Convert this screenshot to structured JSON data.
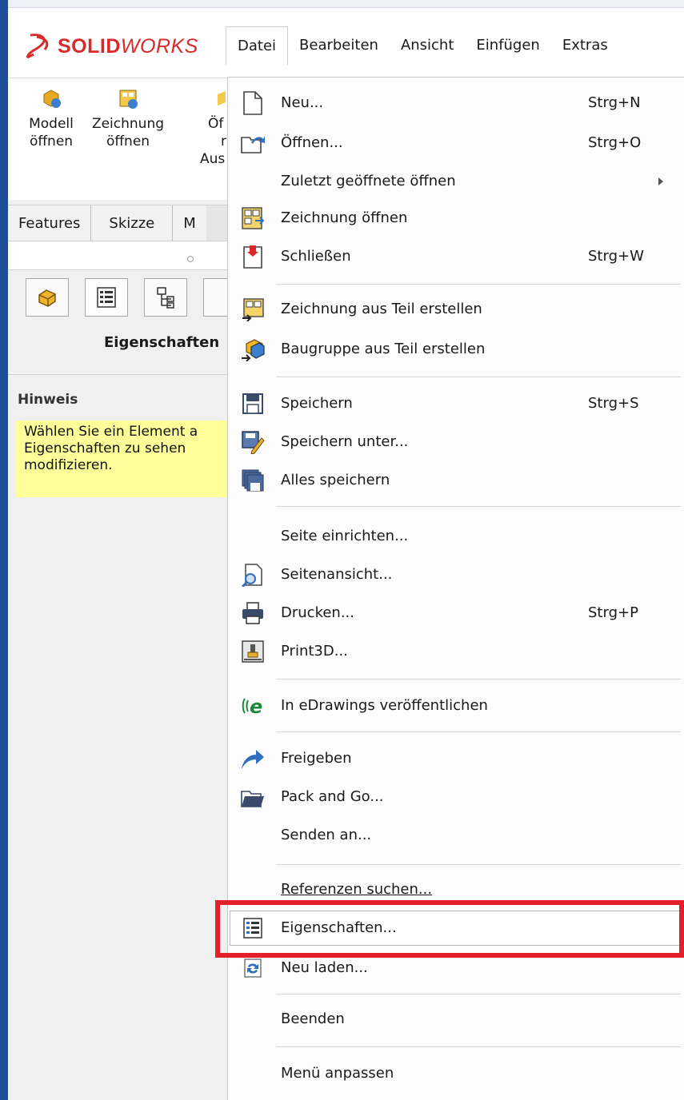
{
  "titlebar": {
    "logo": {
      "ds": "3S",
      "solid": "SOLID",
      "works": "WORKS"
    },
    "menus": [
      {
        "label": "Datei",
        "active": true
      },
      {
        "label": "Bearbeiten"
      },
      {
        "label": "Ansicht"
      },
      {
        "label": "Einfügen"
      },
      {
        "label": "Extras"
      }
    ]
  },
  "command_manager": {
    "items": [
      {
        "line1": "Modell",
        "line2": "öffnen",
        "line3": ""
      },
      {
        "line1": "Zeichnung",
        "line2": "öffnen",
        "line3": ""
      },
      {
        "line1": "Öf",
        "line2": "r",
        "line3": "Aus"
      }
    ]
  },
  "tabs": [
    "Features",
    "Skizze",
    "M"
  ],
  "property_panel": {
    "title": "Eigenschaften",
    "hint_title": "Hinweis",
    "hint_text": "Wählen Sie ein Element a\nEigenschaften zu sehen\nmodifizieren."
  },
  "file_menu": {
    "items": [
      {
        "label": "Neu...",
        "shortcut": "Strg+N",
        "icon": "new-document-icon"
      },
      {
        "label": "Öffnen...",
        "shortcut": "Strg+O",
        "icon": "open-folder-icon"
      },
      {
        "label": "Zuletzt geöffnete öffnen",
        "shortcut": "",
        "icon": "",
        "submenu": true
      },
      {
        "label": "Zeichnung öffnen",
        "shortcut": "",
        "icon": "drawing-open-icon"
      },
      {
        "label": "Schließen",
        "shortcut": "Strg+W",
        "icon": "close-document-icon"
      },
      {
        "label": "Zeichnung aus Teil erstellen",
        "shortcut": "",
        "icon": "drawing-from-part-icon"
      },
      {
        "label": "Baugruppe aus Teil erstellen",
        "shortcut": "",
        "icon": "assembly-from-part-icon"
      },
      {
        "label": "Speichern",
        "shortcut": "Strg+S",
        "icon": "save-icon"
      },
      {
        "label": "Speichern unter...",
        "shortcut": "",
        "icon": "save-as-icon"
      },
      {
        "label": "Alles speichern",
        "shortcut": "",
        "icon": "save-all-icon"
      },
      {
        "label": "Seite einrichten...",
        "shortcut": "",
        "icon": ""
      },
      {
        "label": "Seitenansicht...",
        "shortcut": "",
        "icon": "print-preview-icon"
      },
      {
        "label": "Drucken...",
        "shortcut": "Strg+P",
        "icon": "printer-icon"
      },
      {
        "label": "Print3D...",
        "shortcut": "",
        "icon": "print3d-icon"
      },
      {
        "label": "In eDrawings veröffentlichen",
        "shortcut": "",
        "icon": "edrawings-icon"
      },
      {
        "label": "Freigeben",
        "shortcut": "",
        "icon": "share-arrow-icon"
      },
      {
        "label": "Pack and Go...",
        "shortcut": "",
        "icon": "pack-and-go-icon"
      },
      {
        "label": "Senden an...",
        "shortcut": "",
        "icon": ""
      },
      {
        "label": "Referenzen suchen...",
        "shortcut": "",
        "icon": ""
      },
      {
        "label": "Eigenschaften...",
        "shortcut": "",
        "icon": "properties-icon",
        "hovered": true
      },
      {
        "label": "Neu laden...",
        "shortcut": "",
        "icon": "reload-icon"
      },
      {
        "label": "Beenden",
        "shortcut": "",
        "icon": ""
      },
      {
        "label": "Menü anpassen",
        "shortcut": "",
        "icon": ""
      }
    ]
  },
  "colors": {
    "accent": "#e3202a",
    "hint_background": "#ffff99",
    "logo_red": "#d92a2a"
  }
}
